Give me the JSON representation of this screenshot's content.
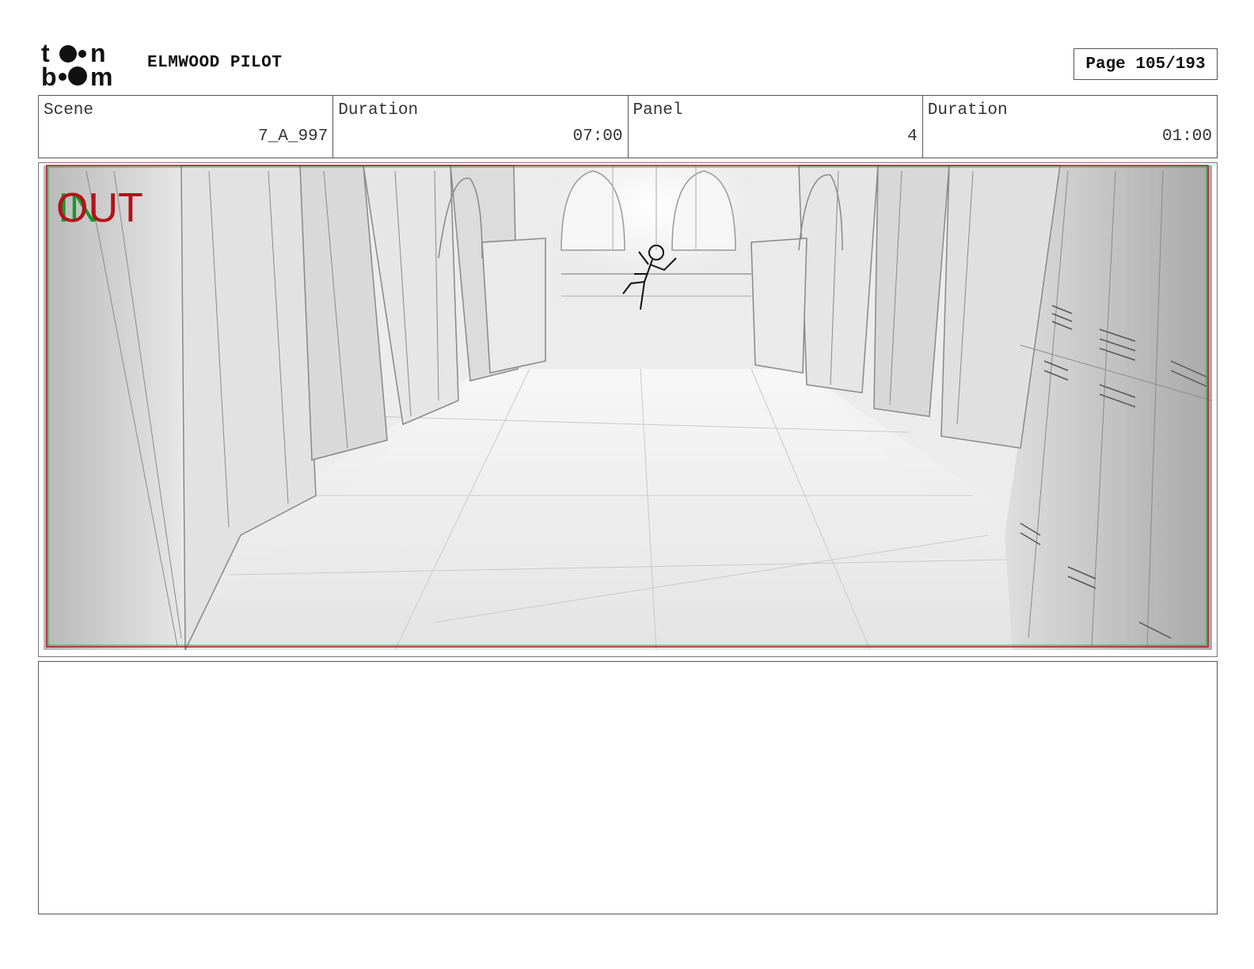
{
  "header": {
    "logo_text": "toon boom",
    "project_title": "ELMWOOD PILOT",
    "page_label": "Page 105/193"
  },
  "info": {
    "scene_label": "Scene",
    "scene_value": "7_A_997",
    "scene_duration_label": "Duration",
    "scene_duration_value": "07:00",
    "panel_label": "Panel",
    "panel_value": "4",
    "panel_duration_label": "Duration",
    "panel_duration_value": "01:00"
  },
  "panel": {
    "transition_out": "OUT",
    "transition_in": "IN",
    "colors": {
      "out": "#b3121b",
      "in": "#1a9a2a"
    }
  },
  "notes": {
    "text": ""
  }
}
